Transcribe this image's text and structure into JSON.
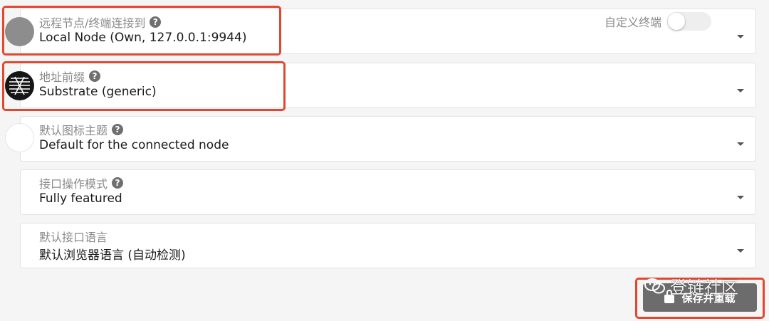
{
  "settings": {
    "remote_node": {
      "label": "远程节点/终端连接到",
      "value": "Local Node (Own, 127.0.0.1:9944)",
      "custom_endpoint_label": "自定义终端",
      "custom_endpoint_enabled": false
    },
    "address_prefix": {
      "label": "地址前缀",
      "value": "Substrate (generic)"
    },
    "icon_theme": {
      "label": "默认图标主题",
      "value": "Default for the connected node"
    },
    "ui_mode": {
      "label": "接口操作模式",
      "value": "Fully featured"
    },
    "ui_language": {
      "label": "默认接口语言",
      "value": "默认浏览器语言 (自动检测)"
    }
  },
  "help_glyph": "?",
  "save_button": {
    "label": "保存并重载"
  },
  "watermark": {
    "text": "登链社区"
  },
  "colors": {
    "highlight": "#e4472f",
    "button": "#6c6c6c"
  },
  "icons": {
    "help": "question-circle-icon",
    "caret": "caret-down-icon",
    "save": "lock-icon"
  }
}
